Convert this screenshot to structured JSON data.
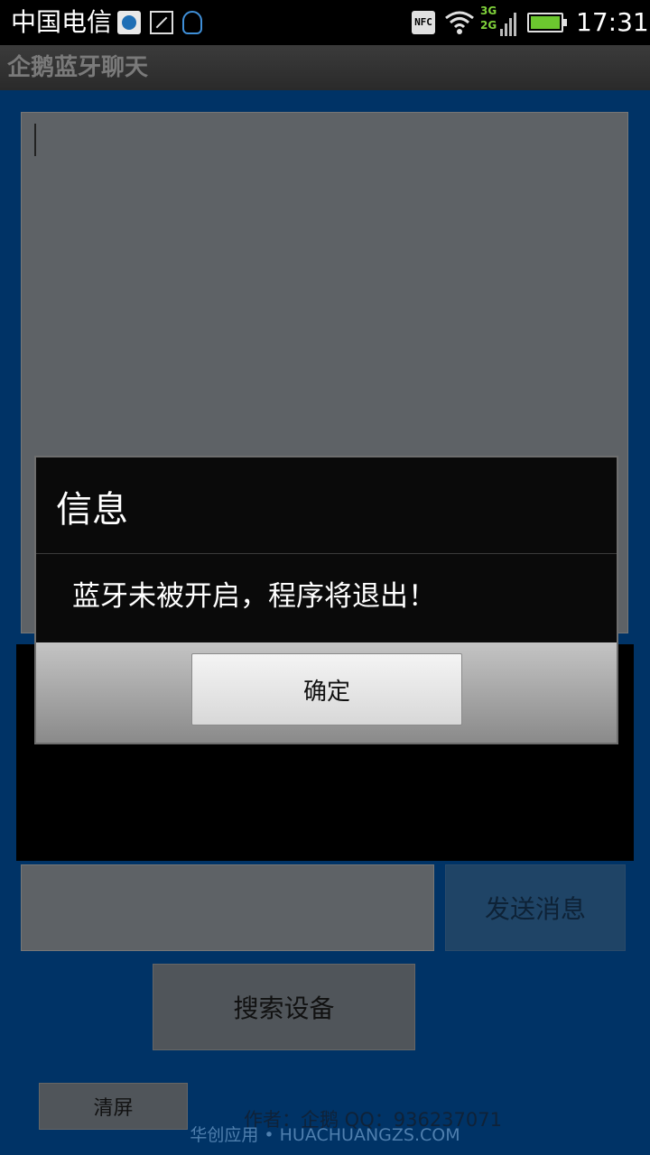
{
  "status_bar": {
    "carrier": "中国电信",
    "time": "17:31",
    "nfc": "NFC",
    "network_top": "3G",
    "network_bottom": "2G",
    "icons": [
      "app-icon",
      "image-icon",
      "qq-penguin-icon",
      "nfc-icon",
      "wifi-icon",
      "signal-icon",
      "battery-icon"
    ]
  },
  "app": {
    "title": "企鹅蓝牙聊天"
  },
  "main": {
    "send_button": "发送消息",
    "search_button": "搜索设备",
    "clear_button": "清屏",
    "author_text": "作者：企鹅 QQ：936237071"
  },
  "dialog": {
    "title": "信息",
    "message": "蓝牙未被开启，程序将退出！",
    "ok_button": "确定"
  },
  "watermark": "华创应用 • HUACHUANGZS.COM",
  "colors": {
    "background": "#003366",
    "dialog_background": "#0a0a0a",
    "status_battery": "#6cc72f",
    "network_text": "#7fd13b"
  }
}
